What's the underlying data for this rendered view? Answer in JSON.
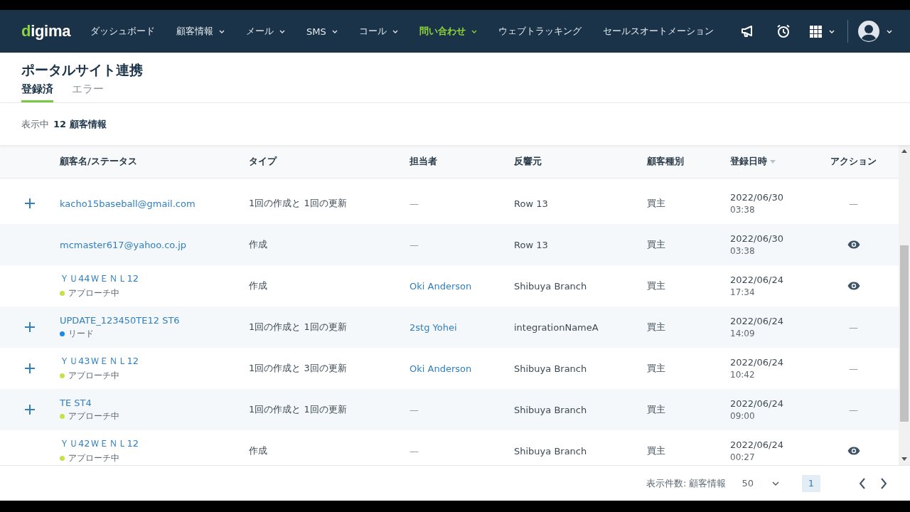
{
  "nav": {
    "logo": "digima",
    "items": [
      {
        "label": "ダッシュボード",
        "dropdown": false,
        "selected": false
      },
      {
        "label": "顧客情報",
        "dropdown": true,
        "selected": false
      },
      {
        "label": "メール",
        "dropdown": true,
        "selected": false
      },
      {
        "label": "SMS",
        "dropdown": true,
        "selected": false
      },
      {
        "label": "コール",
        "dropdown": true,
        "selected": false
      },
      {
        "label": "問い合わせ",
        "dropdown": true,
        "selected": true
      },
      {
        "label": "ウェブトラッキング",
        "dropdown": false,
        "selected": false
      },
      {
        "label": "セールスオートメーション",
        "dropdown": false,
        "selected": false
      }
    ]
  },
  "page": {
    "title": "ポータルサイト連携",
    "tabs": [
      {
        "label": "登録済",
        "selected": true
      },
      {
        "label": "エラー",
        "selected": false
      }
    ],
    "summary": {
      "label": "表示中",
      "count": "12 顧客情報"
    }
  },
  "table": {
    "columns": [
      {
        "label": "顧客名/ステータス",
        "sorted": false
      },
      {
        "label": "タイプ",
        "sorted": false
      },
      {
        "label": "担当者",
        "sorted": false
      },
      {
        "label": "反響元",
        "sorted": false
      },
      {
        "label": "顧客種別",
        "sorted": false
      },
      {
        "label": "登録日時",
        "sorted": true
      },
      {
        "label": "アクション",
        "sorted": false
      }
    ],
    "rows": [
      {
        "expandable": true,
        "name": "kacho15baseball@gmail.com",
        "type": "1回の作成と 1回の更新",
        "owner": "—",
        "owner_link": false,
        "source": "Row 13",
        "customer_type": "買主",
        "date": "2022/06/30",
        "time": "03:38",
        "action": {
          "kind": "text",
          "text": "—"
        }
      },
      {
        "expandable": false,
        "name": "mcmaster617@yahoo.co.jp",
        "type": "作成",
        "owner": "—",
        "owner_link": false,
        "source": "Row 13",
        "customer_type": "買主",
        "date": "2022/06/30",
        "time": "03:38",
        "action": {
          "kind": "view"
        }
      },
      {
        "expandable": false,
        "name": "ＹＵ44ＷＥＮＬ12",
        "status": {
          "label": "アプローチ中",
          "color": "#c8e04a"
        },
        "type": "作成",
        "owner": "Oki Anderson",
        "owner_link": true,
        "source": "Shibuya Branch",
        "customer_type": "買主",
        "date": "2022/06/24",
        "time": "17:34",
        "action": {
          "kind": "view"
        }
      },
      {
        "expandable": true,
        "name": "UPDATE_123450TE12 ST6",
        "status": {
          "label": "リード",
          "color": "#1e88e5"
        },
        "type": "1回の作成と 1回の更新",
        "owner": "2stg Yohei",
        "owner_link": true,
        "source": "integrationNameA",
        "customer_type": "買主",
        "date": "2022/06/24",
        "time": "14:09",
        "action": {
          "kind": "text",
          "text": "—"
        }
      },
      {
        "expandable": true,
        "name": "ＹＵ43ＷＥＮＬ12",
        "status": {
          "label": "アプローチ中",
          "color": "#c8e04a"
        },
        "type": "1回の作成と 3回の更新",
        "owner": "Oki Anderson",
        "owner_link": true,
        "source": "Shibuya Branch",
        "customer_type": "買主",
        "date": "2022/06/24",
        "time": "10:42",
        "action": {
          "kind": "text",
          "text": "—"
        }
      },
      {
        "expandable": true,
        "name": "TE ST4",
        "status": {
          "label": "アプローチ中",
          "color": "#c8e04a"
        },
        "type": "1回の作成と 1回の更新",
        "owner": "—",
        "owner_link": false,
        "source": "Shibuya Branch",
        "customer_type": "買主",
        "date": "2022/06/24",
        "time": "09:00",
        "action": {
          "kind": "text",
          "text": "—"
        }
      },
      {
        "expandable": false,
        "name": "ＹＵ42ＷＥＮＬ12",
        "status": {
          "label": "アプローチ中",
          "color": "#c8e04a"
        },
        "type": "作成",
        "owner": "—",
        "owner_link": false,
        "source": "Shibuya Branch",
        "customer_type": "買主",
        "date": "2022/06/24",
        "time": "00:27",
        "action": {
          "kind": "view"
        }
      }
    ]
  },
  "footer": {
    "per_page_label": "表示件数: 顧客情報",
    "per_page": "50",
    "pages": [
      {
        "label": "1",
        "selected": true
      }
    ]
  }
}
